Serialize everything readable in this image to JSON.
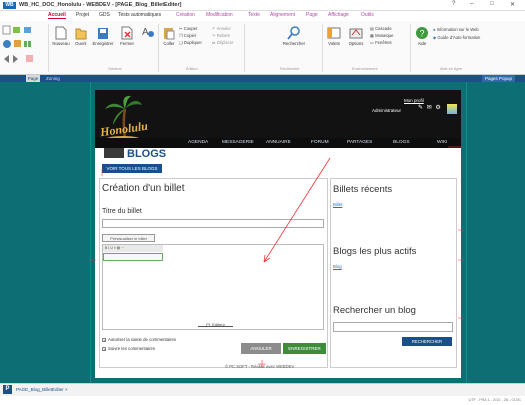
{
  "window": {
    "app_logo": "WB",
    "title": "WB_HC_DOC_Honolulu - WEBDEV - [PAGE_Blog_BilletEditer]",
    "controls": [
      "?",
      "–",
      "□",
      "✕"
    ]
  },
  "ribbon_tabs": [
    {
      "label": "Accueil",
      "active": true
    },
    {
      "label": "Projet"
    },
    {
      "label": "GDS"
    },
    {
      "label": "Tests automatiques"
    },
    {
      "label": "Création"
    },
    {
      "label": "Modification"
    },
    {
      "label": "Texte"
    },
    {
      "label": "Alignement"
    },
    {
      "label": "Page"
    },
    {
      "label": "Affichage"
    },
    {
      "label": "Outils"
    }
  ],
  "ribbon": {
    "buttons": {
      "nouveau": "Nouveau",
      "ouvrir": "Ouvrir",
      "enregistrer": "Enregistrer",
      "fermer": "Fermer",
      "coller": "Coller",
      "couper": "Couper",
      "copier": "Copier",
      "dupliquer": "Dupliquer",
      "annuler": "Annuler",
      "refaire": "Refaire",
      "deplacer": "Déplacer",
      "rechercher": "Rechercher",
      "volets": "Volets",
      "options": "Options",
      "cascade": "Cascade",
      "mosaique": "Mosaïque",
      "fenetres": "Fenêtres",
      "aide": "Aide",
      "info_web": "Information sur le Web",
      "guide": "Guide d'Auto-formation"
    },
    "groups": {
      "general": "Général",
      "edition": "Édition",
      "rechercher": "Rechercher",
      "environnement": "Environnement",
      "aide": "Aide en ligne"
    }
  },
  "editor_tabs": {
    "page": "Page",
    "zoning": "Zoning",
    "page_popup": "Pages Popup"
  },
  "site": {
    "logo": "Honolulu",
    "nav": [
      "AGENDA",
      "MESSAGERIE",
      "ANNUAIRE",
      "FORUM",
      "PARTAGES",
      "BLOGS",
      "WIKI"
    ],
    "mon_profil": "Mon profil",
    "admin_label": "Administrateur",
    "section_title": "BLOGS",
    "voir_tous": "VOIR TOUS LES BLOGS",
    "create_title": "Création d'un billet",
    "titre_label": "Titre du billet",
    "preview_btn": "Prévisualiser le billet",
    "editor_name": "_PI_Editeur",
    "cb_autoriser": "Autoriser la saisie de commentaires",
    "cb_suivre": "Suivre les commentaires",
    "annuler": "ANNULER",
    "enregistrer": "ENREGISTRER",
    "billets_recents": "Billets récents",
    "billet_link": "Billet",
    "blogs_actifs": "Blogs les plus actifs",
    "blog_link": "Blog",
    "rechercher_blog": "Rechercher un blog",
    "rechercher_btn": "RECHERCHER",
    "footer": "© PC SOFT - Réalisé avec WEBDEV"
  },
  "status": {
    "p": "P",
    "file": "PAGE_Blog_BilletEditer ×",
    "bottom": "UTF - FRA 1 - 2/10 - 26 - 01/01"
  }
}
